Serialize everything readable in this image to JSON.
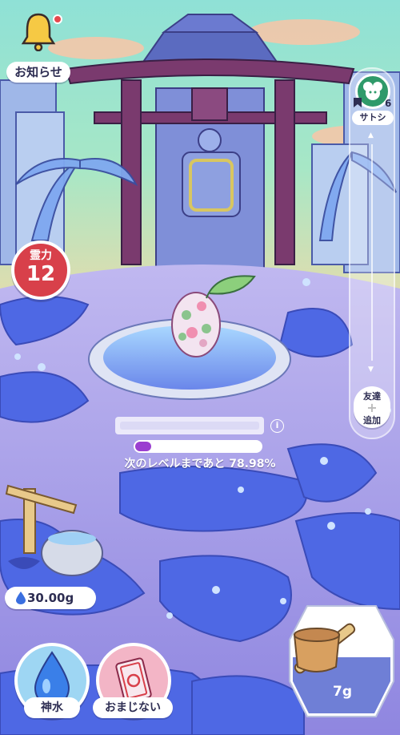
{
  "notifications": {
    "label": "お知らせ",
    "has_unread": true
  },
  "friends": {
    "current": {
      "name": "サトシ",
      "count": "6"
    },
    "add_label_top": "友達",
    "add_label_bottom": "追加"
  },
  "spirit_power": {
    "label": "霊力",
    "value": "12"
  },
  "egg": {
    "level_progress_percent": 13,
    "progress_text": "次のレベルまであと 78.98%"
  },
  "water": {
    "amount": "30.00g"
  },
  "actions": {
    "sacred_water_label": "神水",
    "charm_label": "おまじない"
  },
  "ladle": {
    "amount": "7g"
  },
  "colors": {
    "sky_top": "#8fe1d6",
    "ground_purple": "#a79ce6",
    "spirit_red": "#d8404a",
    "progress_fill": "#9b3fd0",
    "bell_yellow": "#f6c944"
  }
}
